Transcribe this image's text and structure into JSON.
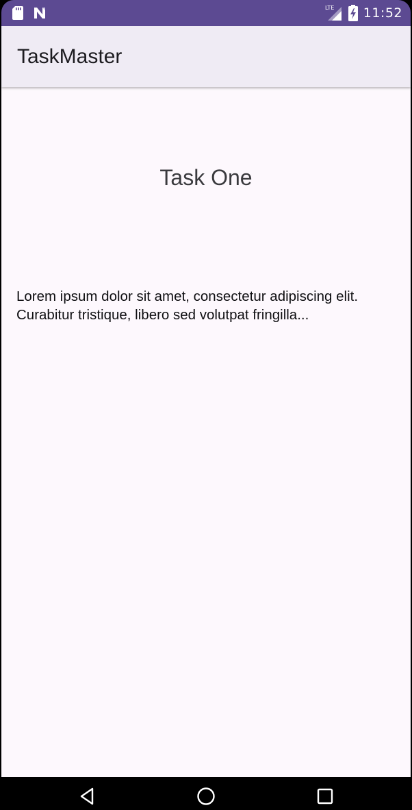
{
  "status_bar": {
    "time": "11:52",
    "network_label": "LTE",
    "icons": [
      "sd-card-icon",
      "n-logo-icon",
      "lte-signal-icon",
      "battery-charging-icon"
    ],
    "background": "#5c4a92"
  },
  "app_bar": {
    "title": "TaskMaster",
    "background": "#efebf4"
  },
  "task": {
    "title": "Task One",
    "body": "Lorem ipsum dolor sit amet, consectetur adipiscing elit. Curabitur tristique, libero sed volutpat fringilla..."
  },
  "nav_bar": {
    "buttons": [
      "back-icon",
      "home-icon",
      "recents-icon"
    ]
  },
  "colors": {
    "content_background": "#fdf8fd",
    "text_primary": "#0f0f12"
  }
}
